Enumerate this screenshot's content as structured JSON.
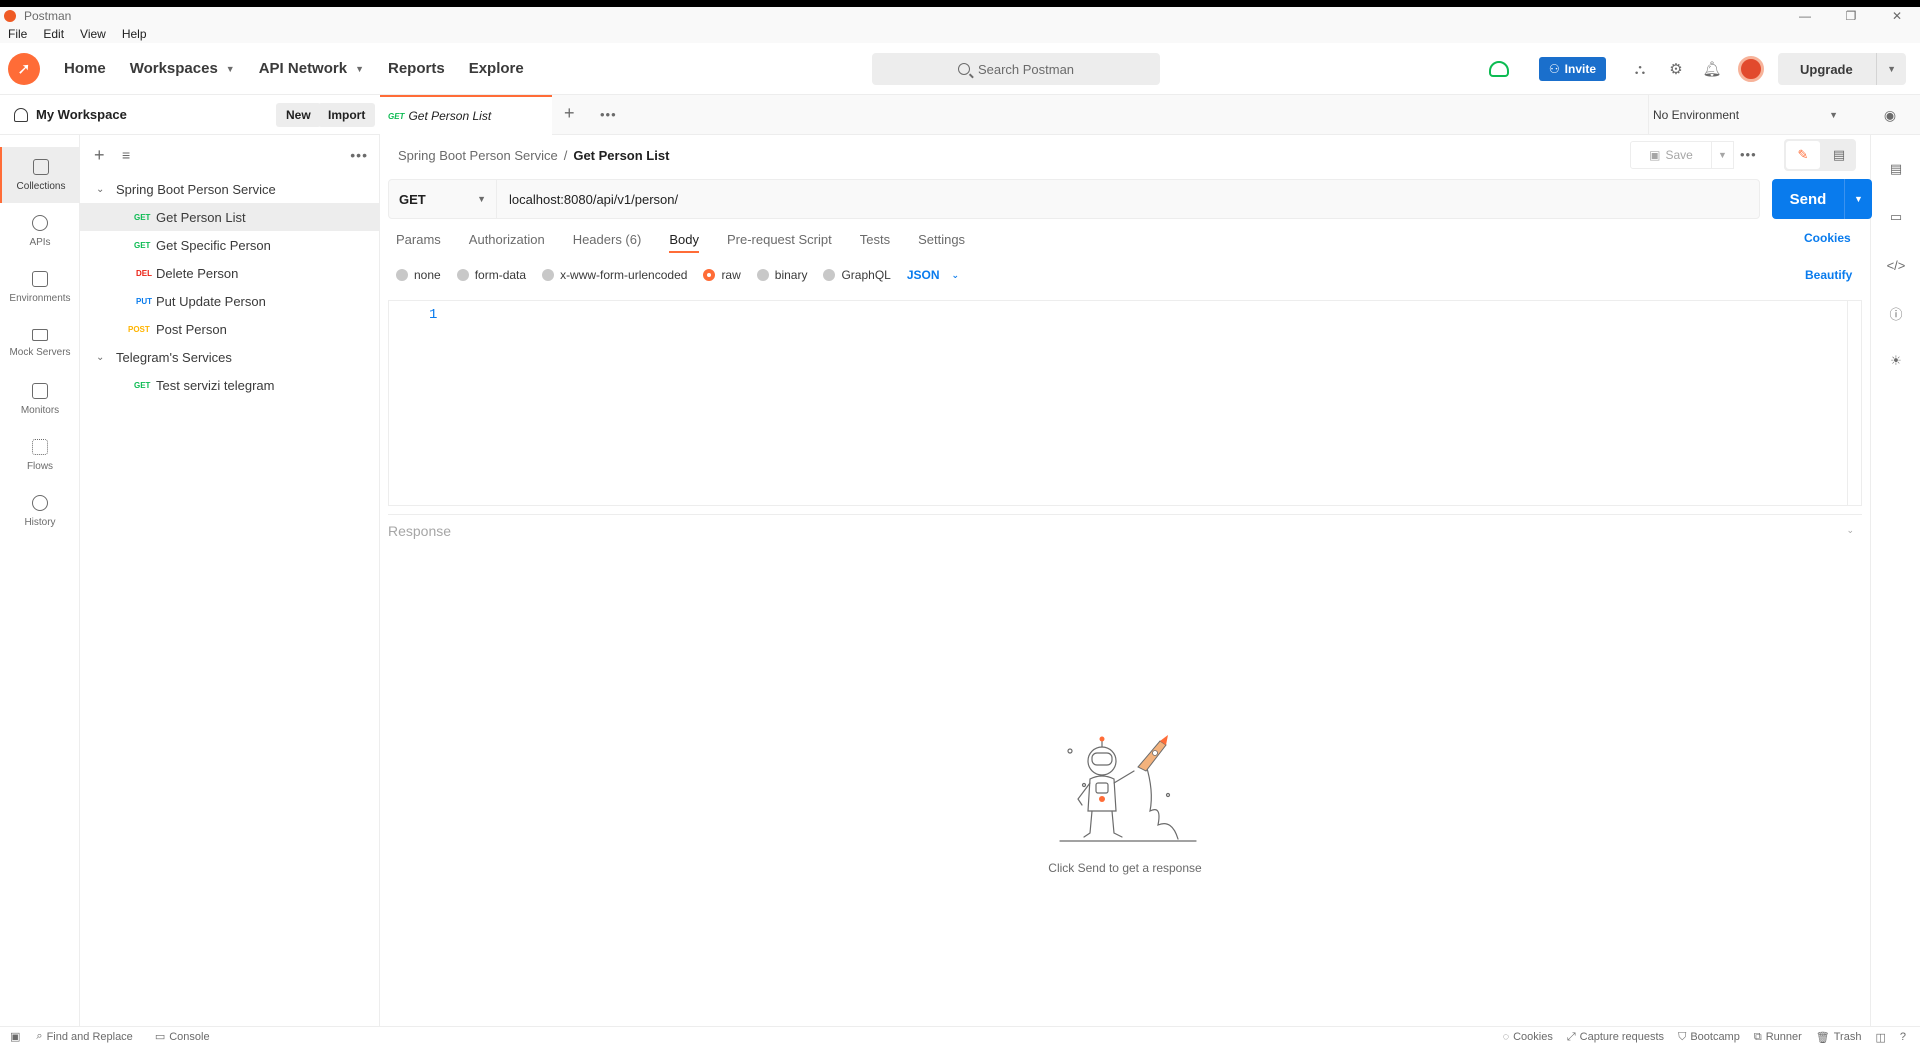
{
  "window": {
    "app_name": "Postman",
    "minimize": "—",
    "restore": "❐",
    "close": "✕"
  },
  "menu": [
    "File",
    "Edit",
    "View",
    "Help"
  ],
  "header": {
    "nav": [
      {
        "label": "Home",
        "has_caret": false
      },
      {
        "label": "Workspaces",
        "has_caret": true
      },
      {
        "label": "API Network",
        "has_caret": true
      },
      {
        "label": "Reports",
        "has_caret": false
      },
      {
        "label": "Explore",
        "has_caret": false
      }
    ],
    "search_placeholder": "Search Postman",
    "invite_label": "Invite",
    "upgrade_label": "Upgrade"
  },
  "workspace": {
    "name": "My Workspace",
    "new_label": "New",
    "import_label": "Import"
  },
  "rail": [
    {
      "label": "Collections",
      "icon": "collections-icon",
      "active": true
    },
    {
      "label": "APIs",
      "icon": "apis-icon",
      "active": false
    },
    {
      "label": "Environments",
      "icon": "environments-icon",
      "active": false
    },
    {
      "label": "Mock Servers",
      "icon": "mock-servers-icon",
      "active": false
    },
    {
      "label": "Monitors",
      "icon": "monitors-icon",
      "active": false
    },
    {
      "label": "Flows",
      "icon": "flows-icon",
      "active": false
    },
    {
      "label": "History",
      "icon": "history-icon",
      "active": false
    }
  ],
  "collections": [
    {
      "name": "Spring Boot Person Service",
      "requests": [
        {
          "method": "GET",
          "name": "Get Person List",
          "selected": true
        },
        {
          "method": "GET",
          "name": "Get Specific Person",
          "selected": false
        },
        {
          "method": "DEL",
          "name": "Delete Person",
          "selected": false
        },
        {
          "method": "PUT",
          "name": "Put Update Person",
          "selected": false
        },
        {
          "method": "POST",
          "name": "Post Person",
          "selected": false
        }
      ]
    },
    {
      "name": "Telegram's Services",
      "requests": [
        {
          "method": "GET",
          "name": "Test servizi telegram",
          "selected": false
        }
      ]
    }
  ],
  "tabs": [
    {
      "method": "GET",
      "title": "Get Person List"
    }
  ],
  "environment": {
    "selected": "No Environment"
  },
  "request": {
    "breadcrumb_parent": "Spring Boot Person Service",
    "breadcrumb_sep": "/",
    "breadcrumb_current": "Get Person List",
    "save_label": "Save",
    "method": "GET",
    "url": "localhost:8080/api/v1/person/",
    "send_label": "Send",
    "tabs": [
      "Params",
      "Authorization",
      "Headers (6)",
      "Body",
      "Pre-request Script",
      "Tests",
      "Settings"
    ],
    "active_tab": "Body",
    "cookies_label": "Cookies",
    "body_types": [
      "none",
      "form-data",
      "x-www-form-urlencoded",
      "raw",
      "binary",
      "GraphQL"
    ],
    "selected_body_type": "raw",
    "language": "JSON",
    "beautify_label": "Beautify",
    "editor_line": "1"
  },
  "response": {
    "label": "Response",
    "empty_text": "Click Send to get a response"
  },
  "statusbar": {
    "left": [
      "Find and Replace",
      "Console"
    ],
    "right": [
      "Cookies",
      "Capture requests",
      "Bootcamp",
      "Runner",
      "Trash"
    ]
  },
  "colors": {
    "brand": "#ff6c37",
    "primary": "#097bed",
    "get": "#0cbb52",
    "delete": "#eb2013",
    "put": "#097bed",
    "post": "#ffb400"
  }
}
